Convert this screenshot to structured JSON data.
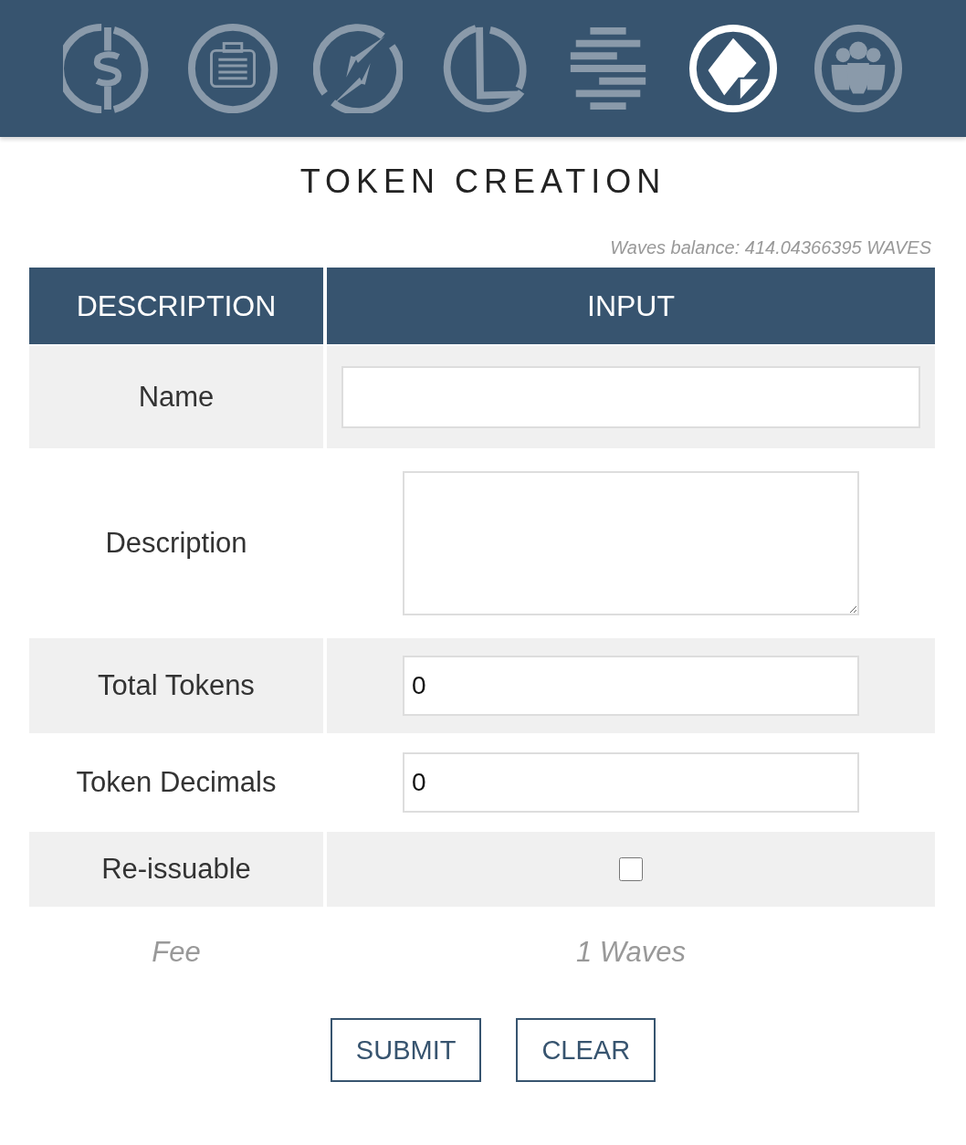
{
  "nav": [
    {
      "kind": "dollar",
      "selected": false
    },
    {
      "kind": "briefcase",
      "selected": false
    },
    {
      "kind": "transfer",
      "selected": false
    },
    {
      "kind": "lease",
      "selected": false
    },
    {
      "kind": "stripes",
      "selected": false
    },
    {
      "kind": "token",
      "selected": true
    },
    {
      "kind": "people",
      "selected": false
    }
  ],
  "title": "TOKEN CREATION",
  "balance": "Waves balance: 414.04366395 WAVES",
  "table": {
    "columns": [
      "DESCRIPTION",
      "INPUT"
    ],
    "rows": [
      {
        "label": "Name",
        "kind": "text"
      },
      {
        "label": "Description",
        "kind": "textarea"
      },
      {
        "label": "Total Tokens",
        "kind": "number",
        "value": "0"
      },
      {
        "label": "Token Decimals",
        "kind": "number",
        "value": "0"
      },
      {
        "label": "Re-issuable",
        "kind": "checkbox",
        "checked": false
      },
      {
        "label": "Fee",
        "kind": "fee",
        "value": "1 Waves"
      }
    ]
  },
  "buttons": [
    "SUBMIT",
    "CLEAR"
  ]
}
